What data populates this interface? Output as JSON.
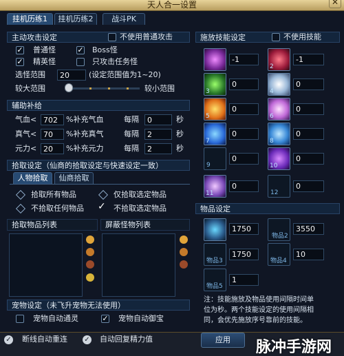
{
  "window": {
    "title": "天人合一设置",
    "close": "✕"
  },
  "tabs": [
    {
      "label": "挂机历练1"
    },
    {
      "label": "挂机历练2"
    },
    {
      "label": "战斗PK"
    }
  ],
  "attack": {
    "header": "主动攻击设定",
    "no_normal": "不使用普通攻击",
    "normal_mon": "普通怪",
    "boss_mon": "Boss怪",
    "elite_mon": "精英怪",
    "task_mon": "只攻击任务怪",
    "range_label": "选怪范围",
    "range_value": "20",
    "range_hint": "(设定范围值为1~20)",
    "big": "较大范围",
    "small": "较小范围",
    "range_level": 0.05
  },
  "supply": {
    "header": "辅助补给",
    "rows": [
      {
        "name": "气血<",
        "val": "702",
        "pct": "%补充气血",
        "every": "每隔",
        "sec": "0",
        "unit": "秒"
      },
      {
        "name": "真气<",
        "val": "70",
        "pct": "%补充真气",
        "every": "每隔",
        "sec": "2",
        "unit": "秒"
      },
      {
        "name": "元力<",
        "val": "20",
        "pct": "%补充元力",
        "every": "每隔",
        "sec": "2",
        "unit": "秒"
      }
    ]
  },
  "pickup": {
    "header": "拾取设定（仙商的拾取设定与快速设定一致）",
    "tab1": "人物拾取",
    "tab2": "仙商拾取",
    "all": "拾取所有物品",
    "sel": "仅拾取选定物品",
    "none": "不拾取任何物品",
    "no_sel": "不拾取选定物品",
    "list1": "拾取物品列表",
    "list2": "屏蔽怪物列表"
  },
  "pet": {
    "header": "宠物设定（未飞升宠物无法使用）",
    "auto_heal": "宠物自动通灵",
    "auto_mount": "宠物自动御宝"
  },
  "skills": {
    "header": "施放技能设定",
    "no_skill": "不使用技能",
    "slots": [
      {
        "num": "",
        "val": "-1"
      },
      {
        "num": "2",
        "val": "-1"
      },
      {
        "num": "3",
        "val": "0"
      },
      {
        "num": "4",
        "val": "0"
      },
      {
        "num": "5",
        "val": "0"
      },
      {
        "num": "6",
        "val": "0"
      },
      {
        "num": "7",
        "val": "0"
      },
      {
        "num": "8",
        "val": "0"
      },
      {
        "num": "9",
        "val": "0"
      },
      {
        "num": "10",
        "val": "0"
      },
      {
        "num": "11",
        "val": "0"
      },
      {
        "num": "12",
        "val": "0"
      },
      {
        "num": "13",
        "val": "0"
      }
    ]
  },
  "items": {
    "header": "物品设定",
    "slots": [
      {
        "label": "",
        "val": "1750"
      },
      {
        "label": "物品2",
        "val": "3550"
      },
      {
        "label": "物品3",
        "val": "1750"
      },
      {
        "label": "物品4",
        "val": "10"
      },
      {
        "label": "物品5",
        "val": "1"
      }
    ]
  },
  "note": {
    "l1": "注：技能施放及物品使用间隔时间单",
    "l2": "位为秒。两个技能设定的使用间隔相",
    "l3": "同，会优先施放序号靠前的技能。"
  },
  "bottom": {
    "reconnect": "断线自动重连",
    "energy": "自动回复精力值",
    "apply": "应用"
  },
  "watermark": "脉冲手游网",
  "colors": {
    "gold": "#e7d39a",
    "panel": "#13253c"
  }
}
